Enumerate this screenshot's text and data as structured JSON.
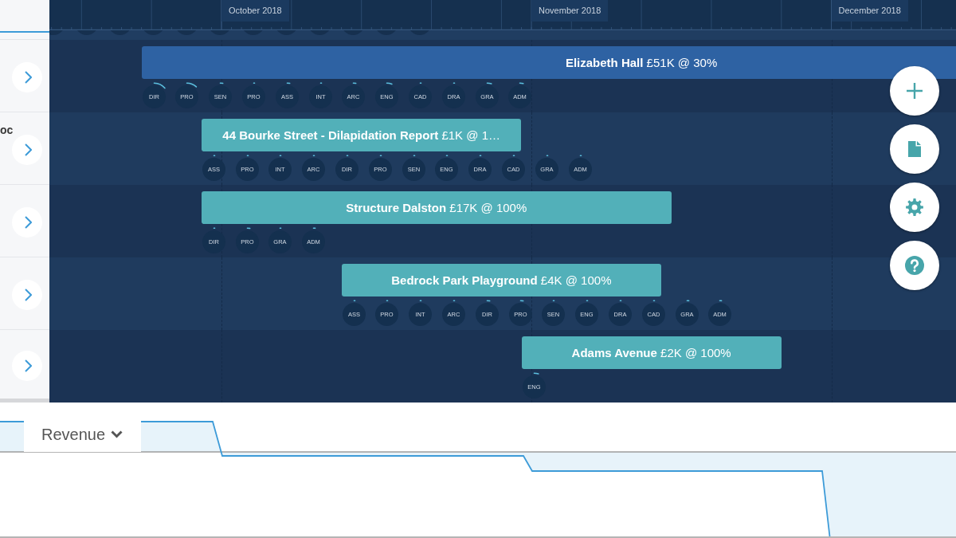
{
  "timeline": {
    "months": [
      {
        "label": "October 2018"
      },
      {
        "label": "November 2018"
      },
      {
        "label": "December 2018"
      }
    ]
  },
  "projects": [
    {
      "title": "**Elizabeth Hall** £51K @ 30%",
      "color": "#2e62a3",
      "roles": [
        {
          "label": "DIR",
          "level": 0.14
        },
        {
          "label": "PRO",
          "level": 0.12
        },
        {
          "label": "SEN",
          "level": 0.03
        },
        {
          "label": "PRO",
          "level": 0.01
        },
        {
          "label": "ASS",
          "level": 0.03
        },
        {
          "label": "INT",
          "level": 0.01
        },
        {
          "label": "ARC",
          "level": 0.03
        },
        {
          "label": "ENG",
          "level": 0.06
        },
        {
          "label": "CAD",
          "level": 0.01
        },
        {
          "label": "DRA",
          "level": 0.01
        },
        {
          "label": "GRA",
          "level": 0.05
        },
        {
          "label": "ADM",
          "level": 0.04
        }
      ]
    },
    {
      "sidebar_label": "oc",
      "title": "**44 Bourke Street - Dilapidation Report** £1K @ 1…",
      "color": "#52b0b9",
      "roles": [
        {
          "label": "ASS",
          "level": 0.01
        },
        {
          "label": "PRO",
          "level": 0.01
        },
        {
          "label": "INT",
          "level": 0.01
        },
        {
          "label": "ARC",
          "level": 0.01
        },
        {
          "label": "DIR",
          "level": 0.01
        },
        {
          "label": "PRO",
          "level": 0.01
        },
        {
          "label": "SEN",
          "level": 0.01
        },
        {
          "label": "ENG",
          "level": 0.01
        },
        {
          "label": "DRA",
          "level": 0.01
        },
        {
          "label": "CAD",
          "level": 0.01
        },
        {
          "label": "GRA",
          "level": 0.01
        },
        {
          "label": "ADM",
          "level": 0.01
        }
      ]
    },
    {
      "title": "**Structure Dalston** £17K @ 100%",
      "color": "#52b0b9",
      "roles": [
        {
          "label": "DIR",
          "level": 0.01
        },
        {
          "label": "PRO",
          "level": 0.03
        },
        {
          "label": "GRA",
          "level": 0.01
        },
        {
          "label": "ADM",
          "level": 0.02
        }
      ]
    },
    {
      "title": "**Bedrock Park Playground** £4K @ 100%",
      "color": "#52b0b9",
      "roles": [
        {
          "label": "ASS",
          "level": 0.01
        },
        {
          "label": "PRO",
          "level": 0.01
        },
        {
          "label": "INT",
          "level": 0.01
        },
        {
          "label": "ARC",
          "level": 0.01
        },
        {
          "label": "DIR",
          "level": 0.03
        },
        {
          "label": "PRO",
          "level": 0.03
        },
        {
          "label": "SEN",
          "level": 0.01
        },
        {
          "label": "ENG",
          "level": 0.01
        },
        {
          "label": "DRA",
          "level": 0.01
        },
        {
          "label": "CAD",
          "level": 0.01
        },
        {
          "label": "GRA",
          "level": 0.02
        },
        {
          "label": "ADM",
          "level": 0.02
        }
      ]
    },
    {
      "title": "**Adams Avenue** £2K @ 100%",
      "color": "#52b0b9",
      "roles": [
        {
          "label": "ENG",
          "level": 0.05
        }
      ]
    }
  ],
  "revenue_panel": {
    "metric": "Revenue"
  }
}
